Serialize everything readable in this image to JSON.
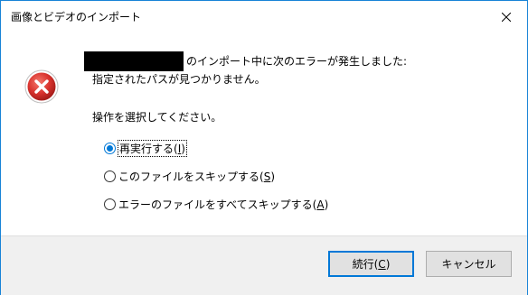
{
  "window": {
    "title": "画像とビデオのインポート",
    "close_glyph": "close-icon"
  },
  "message": {
    "error_icon": "error-icon",
    "line1_suffix": "のインポート中に次のエラーが発生しました:",
    "line2": "指定されたパスが見つかりません。",
    "prompt": "操作を選択してください。"
  },
  "options": [
    {
      "label_before": "再実行する(",
      "mnemonic": "I",
      "label_after": ")",
      "selected": true
    },
    {
      "label_before": "このファイルをスキップする(",
      "mnemonic": "S",
      "label_after": ")",
      "selected": false
    },
    {
      "label_before": "エラーのファイルをすべてスキップする(",
      "mnemonic": "A",
      "label_after": ")",
      "selected": false
    }
  ],
  "buttons": {
    "continue": {
      "label_before": "続行(",
      "mnemonic": "C",
      "label_after": ")"
    },
    "cancel": {
      "label": "キャンセル"
    }
  },
  "colors": {
    "accent": "#0078d7",
    "error_red": "#d9332e",
    "footer_bg": "#f0f0f0",
    "window_border": "#1883d7"
  }
}
